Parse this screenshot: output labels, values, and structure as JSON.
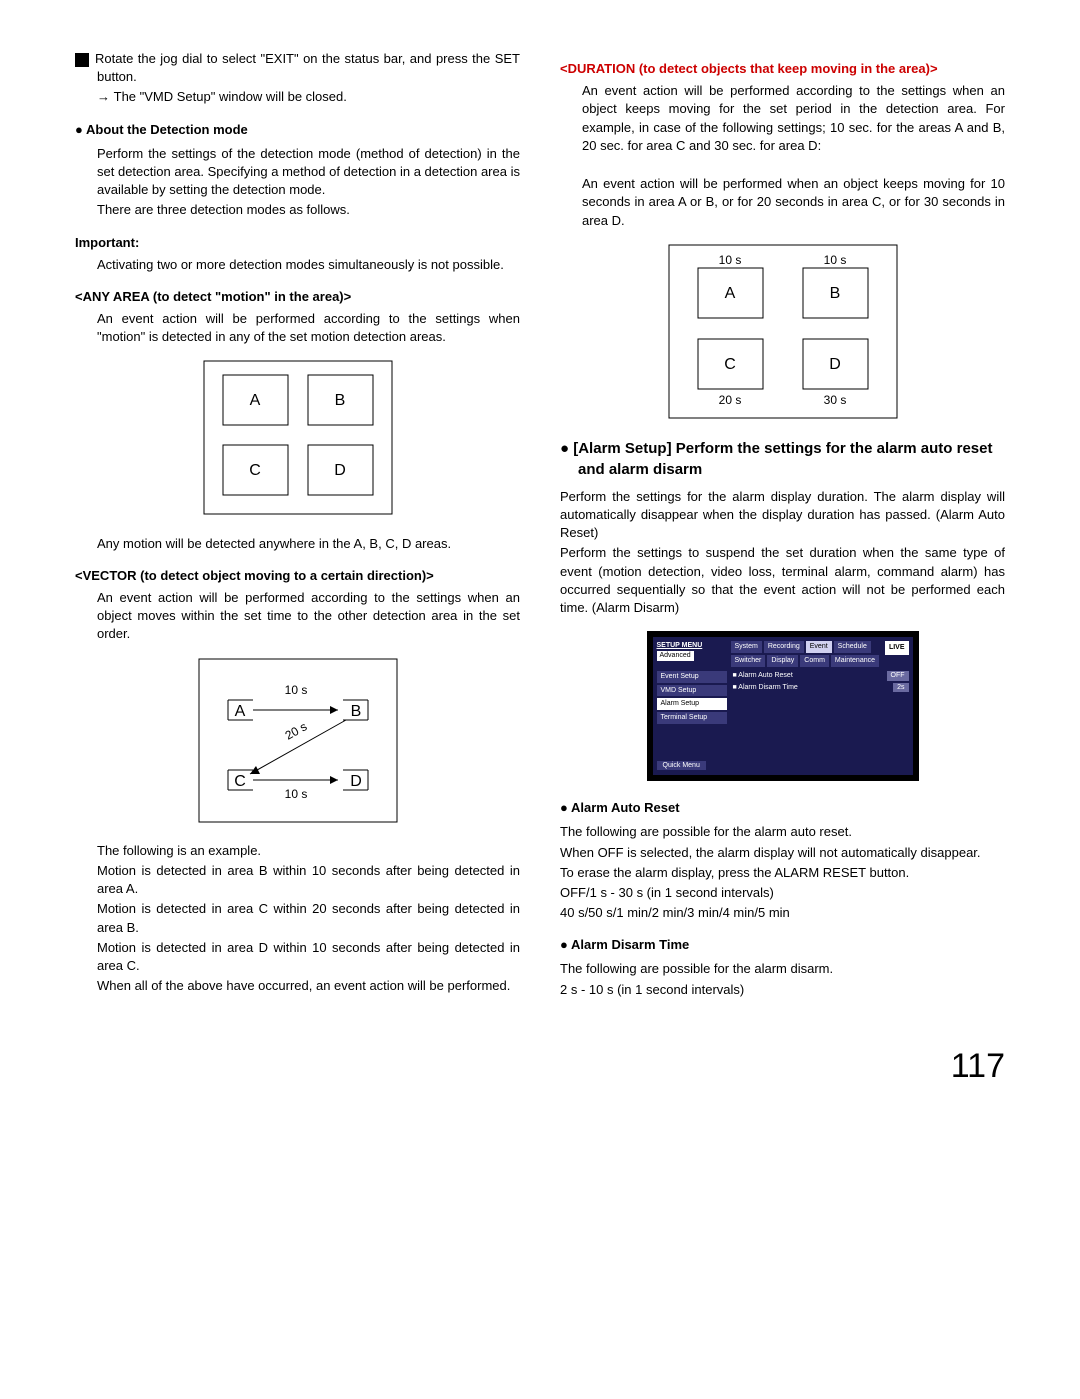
{
  "left": {
    "step4_a": "Rotate the jog dial to select \"EXIT\" on the status bar, and press the SET button.",
    "step4_b": "The \"VMD Setup\" window will be closed.",
    "about_h": "About the Detection mode",
    "about_p1": "Perform the settings of the detection mode (method of detection) in the set detection area. Specifying a method of detection in a detection area is available by setting the detection mode.",
    "about_p2": "There are three detection modes as follows.",
    "important_h": "Important:",
    "important_p": "Activating two or more detection modes simultaneously is not possible.",
    "any_h": "<ANY AREA (to detect \"motion\" in the area)>",
    "any_p": "An event action will be performed according to the settings when \"motion\" is detected in any of the set motion detection areas.",
    "any_after": "Any motion will be detected anywhere in the A, B, C, D areas.",
    "vec_h": "<VECTOR (to detect object moving to a certain direction)>",
    "vec_p": "An event action will be performed according to the settings when an object moves within the set time to the other detection area in the set order.",
    "vec_follow": "The following is an example.",
    "vec_m1": "Motion is detected in area B within 10 seconds after being detected in area A.",
    "vec_m2": "Motion is detected in area C within 20 seconds after being detected in area B.",
    "vec_m3": "Motion is detected in area D within 10 seconds after being detected in area C.",
    "vec_m4": "When all of the above have occurred, an event action will be performed.",
    "labels": {
      "A": "A",
      "B": "B",
      "C": "C",
      "D": "D",
      "t10": "10 s",
      "t20": "20 s",
      "t30": "30 s"
    }
  },
  "right": {
    "dur_h": "<DURATION (to detect objects that keep moving in the area)>",
    "dur_p1": "An event action will be performed according to the settings when an object keeps moving for the set period in the detection area. For example, in case of the following settings; 10 sec. for the areas A and B, 20 sec. for area C and 30 sec. for area D:",
    "dur_p2": "An event action will be performed when an object keeps moving for 10 seconds in area A or B, or for 20 seconds in area C, or for 30 seconds in area D.",
    "alarm_h": "[Alarm Setup] Perform the settings for the alarm auto reset and alarm disarm",
    "alarm_p1": "Perform the settings for the alarm display duration. The alarm display will automatically disappear when the display duration has passed. (Alarm Auto Reset)",
    "alarm_p2": "Perform the settings to suspend the set duration when the same type of event (motion detection, video loss, terminal alarm, command alarm) has occurred sequentially so that the event action will not be performed each time. (Alarm Disarm)",
    "setup": {
      "title1": "SETUP MENU",
      "title2": "Advanced",
      "tabs": [
        "System",
        "Recording",
        "Event",
        "Schedule",
        "Switcher",
        "Display",
        "Comm",
        "Maintenance"
      ],
      "side": [
        "Event Setup",
        "VMD Setup",
        "Alarm Setup",
        "Terminal Setup"
      ],
      "live": "LIVE",
      "quick": "Quick Menu",
      "r1": "Alarm Auto Reset",
      "v1": "OFF",
      "r2": "Alarm Disarm Time",
      "v2": "2s"
    },
    "aar_h": "Alarm Auto Reset",
    "aar_p1": "The following are possible for the alarm auto reset.",
    "aar_p2": "When OFF is selected, the alarm display will not automatically disappear.",
    "aar_p3": "To erase the alarm display, press the ALARM RESET button.",
    "aar_p4": "OFF/1 s - 30 s (in 1 second intervals)",
    "aar_p5": "40 s/50 s/1 min/2 min/3 min/4 min/5 min",
    "adt_h": "Alarm Disarm Time",
    "adt_p1": "The following are possible for the alarm disarm.",
    "adt_p2": "2 s - 10 s (in 1 second intervals)"
  },
  "page": "117"
}
